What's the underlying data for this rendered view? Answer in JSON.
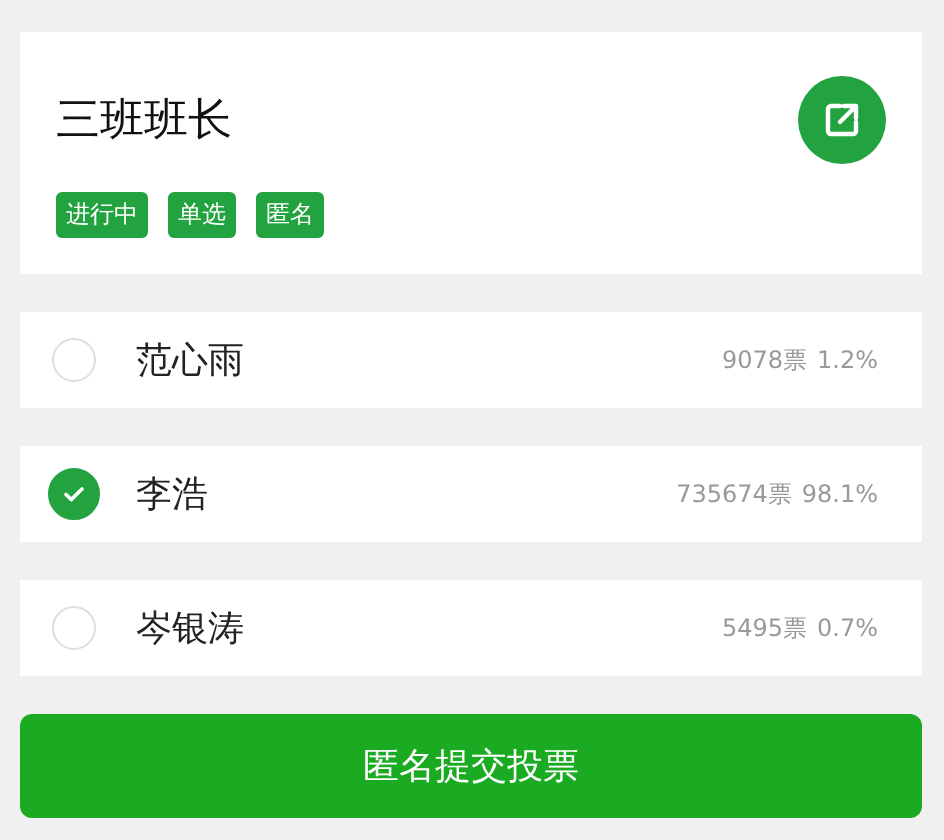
{
  "poll": {
    "title": "三班班长",
    "tags": [
      "进行中",
      "单选",
      "匿名"
    ]
  },
  "options": [
    {
      "name": "范心雨",
      "votes": "9078票",
      "percent": "1.2%",
      "selected": false
    },
    {
      "name": "李浩",
      "votes": "735674票",
      "percent": "98.1%",
      "selected": true
    },
    {
      "name": "岑银涛",
      "votes": "5495票",
      "percent": "0.7%",
      "selected": false
    }
  ],
  "submit_button": "匿名提交投票"
}
